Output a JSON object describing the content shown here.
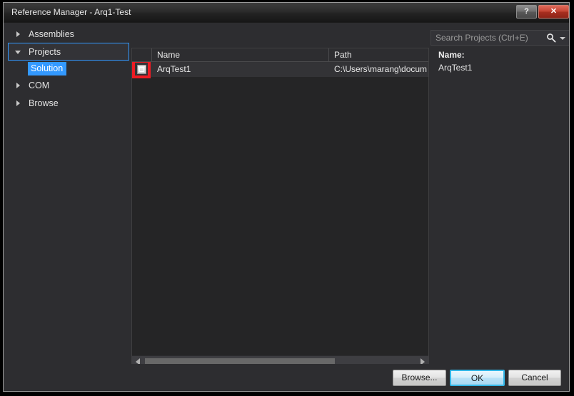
{
  "window": {
    "title": "Reference Manager - Arq1-Test",
    "help_label": "?",
    "close_label": "✕"
  },
  "sidebar": {
    "items": [
      {
        "label": "Assemblies",
        "state": "collapsed",
        "selected": false
      },
      {
        "label": "Projects",
        "state": "expanded",
        "selected": true
      },
      {
        "label": "COM",
        "state": "collapsed",
        "selected": false
      },
      {
        "label": "Browse",
        "state": "collapsed",
        "selected": false
      }
    ],
    "child": {
      "label": "Solution",
      "selected": true
    }
  },
  "search": {
    "placeholder": "Search Projects (Ctrl+E)",
    "value": "",
    "icon": "search-icon",
    "dropdown_icon": "chevron-down-icon"
  },
  "list": {
    "columns": [
      {
        "key": "check",
        "label": ""
      },
      {
        "key": "name",
        "label": "Name"
      },
      {
        "key": "path",
        "label": "Path"
      }
    ],
    "rows": [
      {
        "checked": false,
        "name": "ArqTest1",
        "path": "C:\\Users\\marang\\docum"
      }
    ]
  },
  "scrollbar": {
    "left_arrow": "◀",
    "right_arrow": "▶"
  },
  "detail": {
    "name_label": "Name:",
    "name_value": "ArqTest1"
  },
  "footer": {
    "browse_label": "Browse...",
    "ok_label": "OK",
    "cancel_label": "Cancel"
  },
  "colors": {
    "accent_blue": "#3399ff",
    "highlight_red": "#ee1b23",
    "dialog_bg": "#2d2d30",
    "list_bg": "#252526"
  }
}
